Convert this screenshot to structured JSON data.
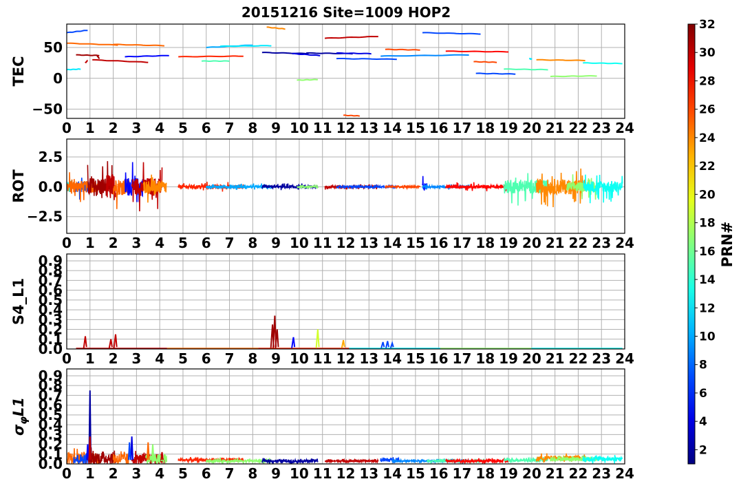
{
  "chart_data": {
    "title": "20151216 Site=1009 HOP2",
    "colorbar": {
      "label": "PRN#",
      "range": [
        1,
        32
      ],
      "ticks": [
        "2",
        "4",
        "6",
        "8",
        "10",
        "12",
        "14",
        "16",
        "18",
        "20",
        "22",
        "24",
        "26",
        "28",
        "30",
        "32"
      ],
      "colormap": "jet"
    },
    "xlim": [
      0,
      24
    ],
    "xticks": [
      "0",
      "1",
      "2",
      "3",
      "4",
      "5",
      "6",
      "7",
      "8",
      "9",
      "10",
      "11",
      "12",
      "13",
      "14",
      "15",
      "16",
      "17",
      "18",
      "19",
      "20",
      "21",
      "22",
      "23",
      "24"
    ],
    "panels": [
      {
        "type": "line",
        "ylabel": "TEC",
        "ylim": [
          -65,
          88
        ],
        "yticks": [
          {
            "v": 50,
            "t": "50"
          },
          {
            "v": 0,
            "t": "0"
          },
          {
            "v": -50,
            "t": "−50"
          }
        ],
        "segments": [
          {
            "prn": 7,
            "x": [
              0.0,
              0.9
            ],
            "y": [
              74,
              78
            ]
          },
          {
            "prn": 25,
            "x": [
              0.0,
              2.2
            ],
            "y": [
              57,
              54
            ]
          },
          {
            "prn": 25,
            "x": [
              2.0,
              4.2
            ],
            "y": [
              55,
              53
            ]
          },
          {
            "prn": 31,
            "x": [
              0.4,
              1.4
            ],
            "y": [
              38,
              37
            ]
          },
          {
            "prn": 31,
            "x": [
              1.3,
              1.4
            ],
            "y": [
              37,
              32
            ]
          },
          {
            "prn": 12,
            "x": [
              0.0,
              0.6
            ],
            "y": [
              14,
              15
            ]
          },
          {
            "prn": 30,
            "x": [
              0.8,
              0.9
            ],
            "y": [
              25,
              29
            ]
          },
          {
            "prn": 30,
            "x": [
              1.1,
              3.5
            ],
            "y": [
              30,
              26
            ]
          },
          {
            "prn": 5,
            "x": [
              2.5,
              4.4
            ],
            "y": [
              35,
              37
            ]
          },
          {
            "prn": 27,
            "x": [
              4.8,
              7.6
            ],
            "y": [
              35,
              36
            ]
          },
          {
            "prn": 15,
            "x": [
              5.8,
              7.0
            ],
            "y": [
              28,
              28
            ]
          },
          {
            "prn": 10,
            "x": [
              6.0,
              8.0
            ],
            "y": [
              50,
              54
            ]
          },
          {
            "prn": 12,
            "x": [
              6.6,
              8.8
            ],
            "y": [
              52,
              53
            ]
          },
          {
            "prn": 24,
            "x": [
              8.6,
              9.4
            ],
            "y": [
              83,
              80
            ]
          },
          {
            "prn": 2,
            "x": [
              8.4,
              10.4
            ],
            "y": [
              42,
              40
            ]
          },
          {
            "prn": 4,
            "x": [
              9.7,
              10.9
            ],
            "y": [
              40,
              37
            ]
          },
          {
            "prn": 17,
            "x": [
              9.9,
              10.8
            ],
            "y": [
              -3,
              -2
            ]
          },
          {
            "prn": 2,
            "x": [
              10.3,
              12.3
            ],
            "y": [
              41,
              40
            ]
          },
          {
            "prn": 30,
            "x": [
              11.1,
              13.4
            ],
            "y": [
              65,
              68
            ]
          },
          {
            "prn": 4,
            "x": [
              11.6,
              13.1
            ],
            "y": [
              41,
              40
            ]
          },
          {
            "prn": 7,
            "x": [
              11.6,
              14.2
            ],
            "y": [
              32,
              31
            ]
          },
          {
            "prn": 26,
            "x": [
              11.9,
              12.6
            ],
            "y": [
              -60,
              -61
            ]
          },
          {
            "prn": 26,
            "x": [
              13.7,
              15.2
            ],
            "y": [
              47,
              46
            ]
          },
          {
            "prn": 9,
            "x": [
              13.5,
              17.3
            ],
            "y": [
              36,
              38
            ]
          },
          {
            "prn": 7,
            "x": [
              15.3,
              17.8
            ],
            "y": [
              74,
              72
            ]
          },
          {
            "prn": 28,
            "x": [
              16.3,
              19.0
            ],
            "y": [
              44,
              43
            ]
          },
          {
            "prn": 26,
            "x": [
              17.5,
              18.5
            ],
            "y": [
              27,
              26
            ]
          },
          {
            "prn": 7,
            "x": [
              17.6,
              19.3
            ],
            "y": [
              8,
              7
            ]
          },
          {
            "prn": 15,
            "x": [
              18.8,
              20.7
            ],
            "y": [
              15,
              14
            ]
          },
          {
            "prn": 12,
            "x": [
              19.9,
              20.0
            ],
            "y": [
              32,
              31
            ]
          },
          {
            "prn": 24,
            "x": [
              20.2,
              22.3
            ],
            "y": [
              30,
              29
            ]
          },
          {
            "prn": 17,
            "x": [
              20.8,
              22.8
            ],
            "y": [
              3,
              4
            ]
          },
          {
            "prn": 13,
            "x": [
              22.2,
              23.9
            ],
            "y": [
              25,
              24
            ]
          }
        ]
      },
      {
        "type": "line",
        "ylabel": "ROT",
        "ylim": [
          -3.9,
          4.0
        ],
        "yticks": [
          {
            "v": 2.5,
            "t": "2.5"
          },
          {
            "v": 0,
            "t": "0.0"
          },
          {
            "v": -2.5,
            "t": "−2.5"
          }
        ],
        "segments": [
          {
            "prn": 13,
            "x": [
              0.0,
              0.3
            ],
            "amp": 1.6
          },
          {
            "prn": 7,
            "x": [
              0.3,
              1.0
            ],
            "amp": 1.3
          },
          {
            "prn": 25,
            "x": [
              0.0,
              1.4
            ],
            "amp": 1.4
          },
          {
            "prn": 31,
            "x": [
              0.9,
              2.0
            ],
            "amp": 2.2
          },
          {
            "prn": 30,
            "x": [
              1.7,
              2.1
            ],
            "amp": 3.2
          },
          {
            "prn": 25,
            "x": [
              2.0,
              2.7
            ],
            "amp": 2.0
          },
          {
            "prn": 5,
            "x": [
              2.5,
              3.3
            ],
            "amp": 2.2
          },
          {
            "prn": 30,
            "x": [
              2.8,
              4.1
            ],
            "amp": 2.2
          },
          {
            "prn": 24,
            "x": [
              3.3,
              4.3
            ],
            "amp": 1.5
          },
          {
            "prn": 27,
            "x": [
              4.8,
              7.6
            ],
            "amp": 0.45
          },
          {
            "prn": 10,
            "x": [
              6.0,
              8.8
            ],
            "amp": 0.3
          },
          {
            "prn": 2,
            "x": [
              8.4,
              10.8
            ],
            "amp": 0.3
          },
          {
            "prn": 17,
            "x": [
              9.9,
              10.8
            ],
            "amp": 0.2
          },
          {
            "prn": 30,
            "x": [
              11.1,
              13.4
            ],
            "amp": 0.25
          },
          {
            "prn": 7,
            "x": [
              11.6,
              14.2
            ],
            "amp": 0.2
          },
          {
            "prn": 26,
            "x": [
              13.7,
              15.2
            ],
            "amp": 0.2
          },
          {
            "prn": 5,
            "x": [
              15.3,
              15.5
            ],
            "amp": 0.9
          },
          {
            "prn": 9,
            "x": [
              15.3,
              17.3
            ],
            "amp": 0.25
          },
          {
            "prn": 28,
            "x": [
              16.3,
              19.0
            ],
            "amp": 0.4
          },
          {
            "prn": 15,
            "x": [
              18.8,
              20.7
            ],
            "amp": 1.6
          },
          {
            "prn": 24,
            "x": [
              20.2,
              22.3
            ],
            "amp": 1.8
          },
          {
            "prn": 17,
            "x": [
              21.5,
              22.8
            ],
            "amp": 1.1
          },
          {
            "prn": 13,
            "x": [
              22.2,
              23.9
            ],
            "amp": 1.4
          }
        ]
      },
      {
        "type": "line",
        "ylabel": "S4_L1",
        "ylim": [
          0,
          0.97
        ],
        "yticks": [
          {
            "v": 0.9,
            "t": "0.9"
          },
          {
            "v": 0.8,
            "t": "0.8"
          },
          {
            "v": 0.7,
            "t": "0.7"
          },
          {
            "v": 0.6,
            "t": "0.6"
          },
          {
            "v": 0.5,
            "t": "0.5"
          },
          {
            "v": 0.4,
            "t": "0.4"
          },
          {
            "v": 0.3,
            "t": "0.3"
          },
          {
            "v": 0.2,
            "t": "0.2"
          },
          {
            "v": 0.1,
            "t": "0.1"
          },
          {
            "v": 0.0,
            "t": "0.0"
          }
        ],
        "baseline": {
          "x": [
            0.4,
            23.9
          ],
          "y": 0.005,
          "prns": [
            30,
            25,
            27,
            12,
            17,
            13
          ]
        },
        "spikes": [
          {
            "prn": 30,
            "x": 0.8,
            "y": 0.13
          },
          {
            "prn": 30,
            "x": 1.9,
            "y": 0.1
          },
          {
            "prn": 30,
            "x": 2.1,
            "y": 0.15
          },
          {
            "prn": 31,
            "x": 8.85,
            "y": 0.25
          },
          {
            "prn": 31,
            "x": 8.95,
            "y": 0.34
          },
          {
            "prn": 31,
            "x": 9.05,
            "y": 0.2
          },
          {
            "prn": 5,
            "x": 9.75,
            "y": 0.12
          },
          {
            "prn": 19,
            "x": 10.8,
            "y": 0.2
          },
          {
            "prn": 23,
            "x": 11.9,
            "y": 0.09
          },
          {
            "prn": 7,
            "x": 13.6,
            "y": 0.07
          },
          {
            "prn": 7,
            "x": 13.8,
            "y": 0.08
          },
          {
            "prn": 7,
            "x": 14.0,
            "y": 0.06
          }
        ]
      },
      {
        "type": "line",
        "ylabel": "σφL1",
        "ylim": [
          0,
          0.97
        ],
        "yticks": [
          {
            "v": 0.9,
            "t": "0.9"
          },
          {
            "v": 0.8,
            "t": "0.8"
          },
          {
            "v": 0.7,
            "t": "0.7"
          },
          {
            "v": 0.6,
            "t": "0.6"
          },
          {
            "v": 0.5,
            "t": "0.5"
          },
          {
            "v": 0.4,
            "t": "0.4"
          },
          {
            "v": 0.3,
            "t": "0.3"
          },
          {
            "v": 0.2,
            "t": "0.2"
          },
          {
            "v": 0.1,
            "t": "0.1"
          },
          {
            "v": 0.0,
            "t": "0.0"
          }
        ],
        "segments": [
          {
            "prn": 25,
            "x": [
              0.0,
              1.4
            ],
            "base": 0.06,
            "amp": 0.12
          },
          {
            "prn": 7,
            "x": [
              0.3,
              1.0
            ],
            "base": 0.05,
            "amp": 0.1
          },
          {
            "prn": 31,
            "x": [
              0.9,
              2.1
            ],
            "base": 0.06,
            "amp": 0.12
          },
          {
            "prn": 25,
            "x": [
              2.0,
              2.7
            ],
            "base": 0.05,
            "amp": 0.12
          },
          {
            "prn": 30,
            "x": [
              2.8,
              4.2
            ],
            "base": 0.05,
            "amp": 0.1
          },
          {
            "prn": 17,
            "x": [
              3.4,
              4.3
            ],
            "base": 0.05,
            "amp": 0.1
          },
          {
            "prn": 27,
            "x": [
              4.8,
              7.6
            ],
            "base": 0.04,
            "amp": 0.03
          },
          {
            "prn": 17,
            "x": [
              6.0,
              8.8
            ],
            "base": 0.03,
            "amp": 0.03
          },
          {
            "prn": 2,
            "x": [
              8.4,
              10.8
            ],
            "base": 0.03,
            "amp": 0.03
          },
          {
            "prn": 30,
            "x": [
              11.1,
              13.4
            ],
            "base": 0.03,
            "amp": 0.02
          },
          {
            "prn": 7,
            "x": [
              13.5,
              14.3
            ],
            "base": 0.04,
            "amp": 0.04
          },
          {
            "prn": 9,
            "x": [
              14.0,
              17.3
            ],
            "base": 0.03,
            "amp": 0.02
          },
          {
            "prn": 15,
            "x": [
              15.5,
              18.0
            ],
            "base": 0.03,
            "amp": 0.02
          },
          {
            "prn": 28,
            "x": [
              16.3,
              19.0
            ],
            "base": 0.03,
            "amp": 0.03
          },
          {
            "prn": 15,
            "x": [
              18.8,
              20.7
            ],
            "base": 0.04,
            "amp": 0.03
          },
          {
            "prn": 24,
            "x": [
              20.2,
              22.3
            ],
            "base": 0.06,
            "amp": 0.05
          },
          {
            "prn": 17,
            "x": [
              20.8,
              22.8
            ],
            "base": 0.05,
            "amp": 0.04
          },
          {
            "prn": 13,
            "x": [
              22.2,
              23.9
            ],
            "base": 0.05,
            "amp": 0.05
          }
        ],
        "spikes": [
          {
            "prn": 2,
            "x": 1.0,
            "y": 0.75
          },
          {
            "prn": 5,
            "x": 0.9,
            "y": 0.2
          },
          {
            "prn": 30,
            "x": 1.0,
            "y": 0.28
          },
          {
            "prn": 4,
            "x": 2.8,
            "y": 0.28
          },
          {
            "prn": 7,
            "x": 2.7,
            "y": 0.22
          },
          {
            "prn": 25,
            "x": 3.5,
            "y": 0.22
          },
          {
            "prn": 17,
            "x": 3.7,
            "y": 0.2
          },
          {
            "prn": 30,
            "x": 4.1,
            "y": 0.12
          }
        ]
      }
    ]
  }
}
